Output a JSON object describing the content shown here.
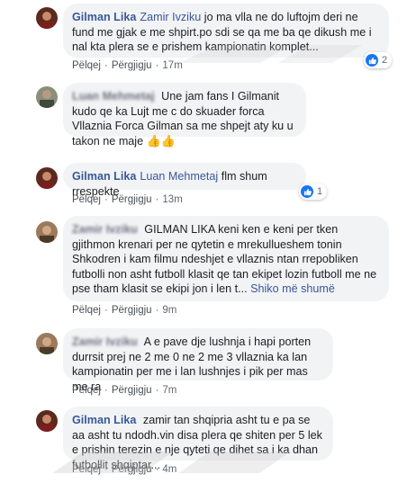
{
  "actions": {
    "like": "Pëlqej",
    "reply": "Përgjigju",
    "sep": "·"
  },
  "comments": [
    {
      "author": "Gilman Lika",
      "tag": "Zamir Ivziku",
      "text": "jo ma vlla ne do luftojm deri ne fund me gjak e me shpirt.po sdi se qa me ba qe dikush me i nal kta plera se e prishem kampionatin komplet...",
      "time": "17m",
      "reactions": "2"
    },
    {
      "author": "Luan Mehmetaj",
      "text": "Une jam fans I Gilmanit kudo qe ka Lujt me c do skuader forca Vllaznia Forca Gilman sa me shpejt aty ku u takon ne maje",
      "emoji": "👍👍"
    },
    {
      "author": "Gilman Lika",
      "tag": "Luan Mehmetaj",
      "text": "flm shum rrespekte",
      "time": "13m",
      "reactions": "1"
    },
    {
      "author": "Zamir Ivziku",
      "text": "GILMAN LIKA keni ken e keni per tken gjithmon krenari per ne qytetin e mrekullueshem tonin Shkodren i kam filmu ndeshjet e vllaznis ntan rrepobliken futbolli non asht futboll klasit qe tan ekipet lozin futboll me ne pse tham klasit se ekipi jon i len t...",
      "seemore": "Shiko më shumë",
      "time": "9m"
    },
    {
      "author": "Zamir Ivziku",
      "text": "A e pave dje lushnja i hapi porten durrsit prej ne 2 me 0 ne 2 me 3 vllaznia ka lan kampionatin per me i lan lushnjes i pik per mas me ra",
      "time": "7m"
    },
    {
      "author": "Gilman Lika",
      "text": "zamir tan shqipria asht tu e pa se aa asht tu ndodh.vin disa plera qe shiten per 5 lek e prishin terezin e nje qyteti qe dihet sa i ka dhan futbollit shqiptar...",
      "time": "4m"
    }
  ],
  "colors": {
    "link": "#385898",
    "bubble": "#f2f3f5",
    "like": "#1877f2"
  }
}
